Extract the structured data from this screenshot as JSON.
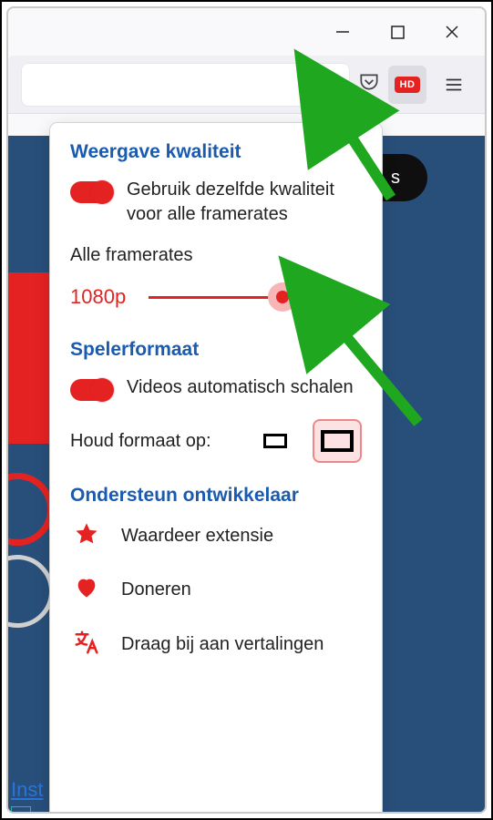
{
  "extension_badge": "HD",
  "popup": {
    "section_quality": "Weergave kwaliteit",
    "same_quality_label": "Gebruik dezelfde kwaliteit voor alle framerates",
    "all_framerates_label": "Alle framerates",
    "resolution_value": "1080p",
    "section_format": "Spelerformaat",
    "auto_scale_label": "Videos automatisch schalen",
    "keep_format_label": "Houd formaat op:",
    "section_support": "Ondersteun ontwikkelaar",
    "rate_label": "Waardeer extensie",
    "donate_label": "Doneren",
    "translate_label": "Draag bij aan vertalingen"
  },
  "bg": {
    "inst": "Inst",
    "pill": "s"
  }
}
